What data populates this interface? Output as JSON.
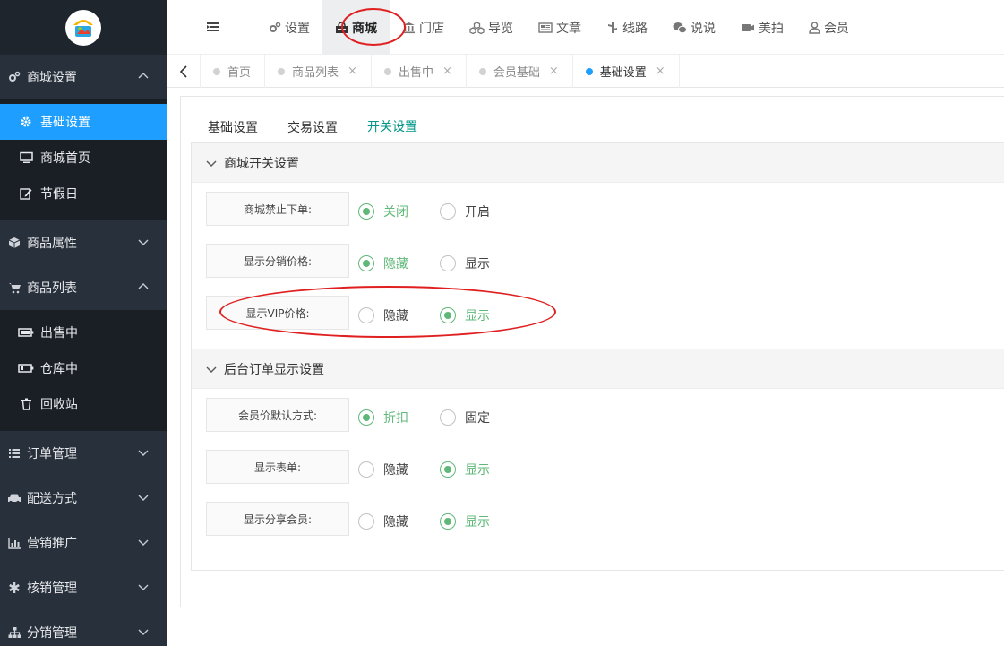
{
  "sidebar": {
    "groups": [
      {
        "label": "商城设置",
        "icon": "gears-icon",
        "expanded": true,
        "items": [
          {
            "label": "基础设置",
            "icon": "gear-icon",
            "active": true
          },
          {
            "label": "商城首页",
            "icon": "monitor-icon"
          },
          {
            "label": "节假日",
            "icon": "edit-icon"
          }
        ]
      },
      {
        "label": "商品属性",
        "icon": "cube-icon"
      },
      {
        "label": "商品列表",
        "icon": "cart-icon",
        "expanded": true,
        "items": [
          {
            "label": "出售中",
            "icon": "battery-full-icon"
          },
          {
            "label": "仓库中",
            "icon": "battery-low-icon"
          },
          {
            "label": "回收站",
            "icon": "trash-icon"
          }
        ]
      },
      {
        "label": "订单管理",
        "icon": "list-icon"
      },
      {
        "label": "配送方式",
        "icon": "car-icon"
      },
      {
        "label": "营销推广",
        "icon": "bar-chart-icon"
      },
      {
        "label": "核销管理",
        "icon": "asterisk-icon"
      },
      {
        "label": "分销管理",
        "icon": "sitemap-icon"
      }
    ]
  },
  "topnav": {
    "items": [
      {
        "label": "设置",
        "icon": "gears-icon"
      },
      {
        "label": "商城",
        "icon": "shop-icon",
        "active": true
      },
      {
        "label": "门店",
        "icon": "bank-icon"
      },
      {
        "label": "导览",
        "icon": "cubes-icon"
      },
      {
        "label": "文章",
        "icon": "newspaper-icon"
      },
      {
        "label": "线路",
        "icon": "road-icon"
      },
      {
        "label": "说说",
        "icon": "wechat-icon"
      },
      {
        "label": "美拍",
        "icon": "video-icon"
      },
      {
        "label": "会员",
        "icon": "user-icon"
      }
    ]
  },
  "tabs": [
    {
      "label": "首页",
      "closable": false
    },
    {
      "label": "商品列表",
      "closable": true
    },
    {
      "label": "出售中",
      "closable": true
    },
    {
      "label": "会员基础",
      "closable": true
    },
    {
      "label": "基础设置",
      "closable": true,
      "active": true
    }
  ],
  "tab_close_glyph": "×",
  "subtabs": [
    {
      "label": "基础设置"
    },
    {
      "label": "交易设置"
    },
    {
      "label": "开关设置",
      "active": true
    }
  ],
  "sections": [
    {
      "title": "商城开关设置",
      "rows": [
        {
          "label": "商城禁止下单:",
          "options": [
            "关闭",
            "开启"
          ],
          "selected": 0
        },
        {
          "label": "显示分销价格:",
          "options": [
            "隐藏",
            "显示"
          ],
          "selected": 0
        },
        {
          "label": "显示VIP价格:",
          "options": [
            "隐藏",
            "显示"
          ],
          "selected": 1
        }
      ]
    },
    {
      "title": "后台订单显示设置",
      "rows": [
        {
          "label": "会员价默认方式:",
          "options": [
            "折扣",
            "固定"
          ],
          "selected": 0
        },
        {
          "label": "显示表单:",
          "options": [
            "隐藏",
            "显示"
          ],
          "selected": 1
        },
        {
          "label": "显示分享会员:",
          "options": [
            "隐藏",
            "显示"
          ],
          "selected": 1
        }
      ]
    }
  ],
  "colors": {
    "accent": "#1e9fff",
    "radio_on": "#5FB878",
    "tab_active": "#009688",
    "annotation": "#e02020"
  }
}
